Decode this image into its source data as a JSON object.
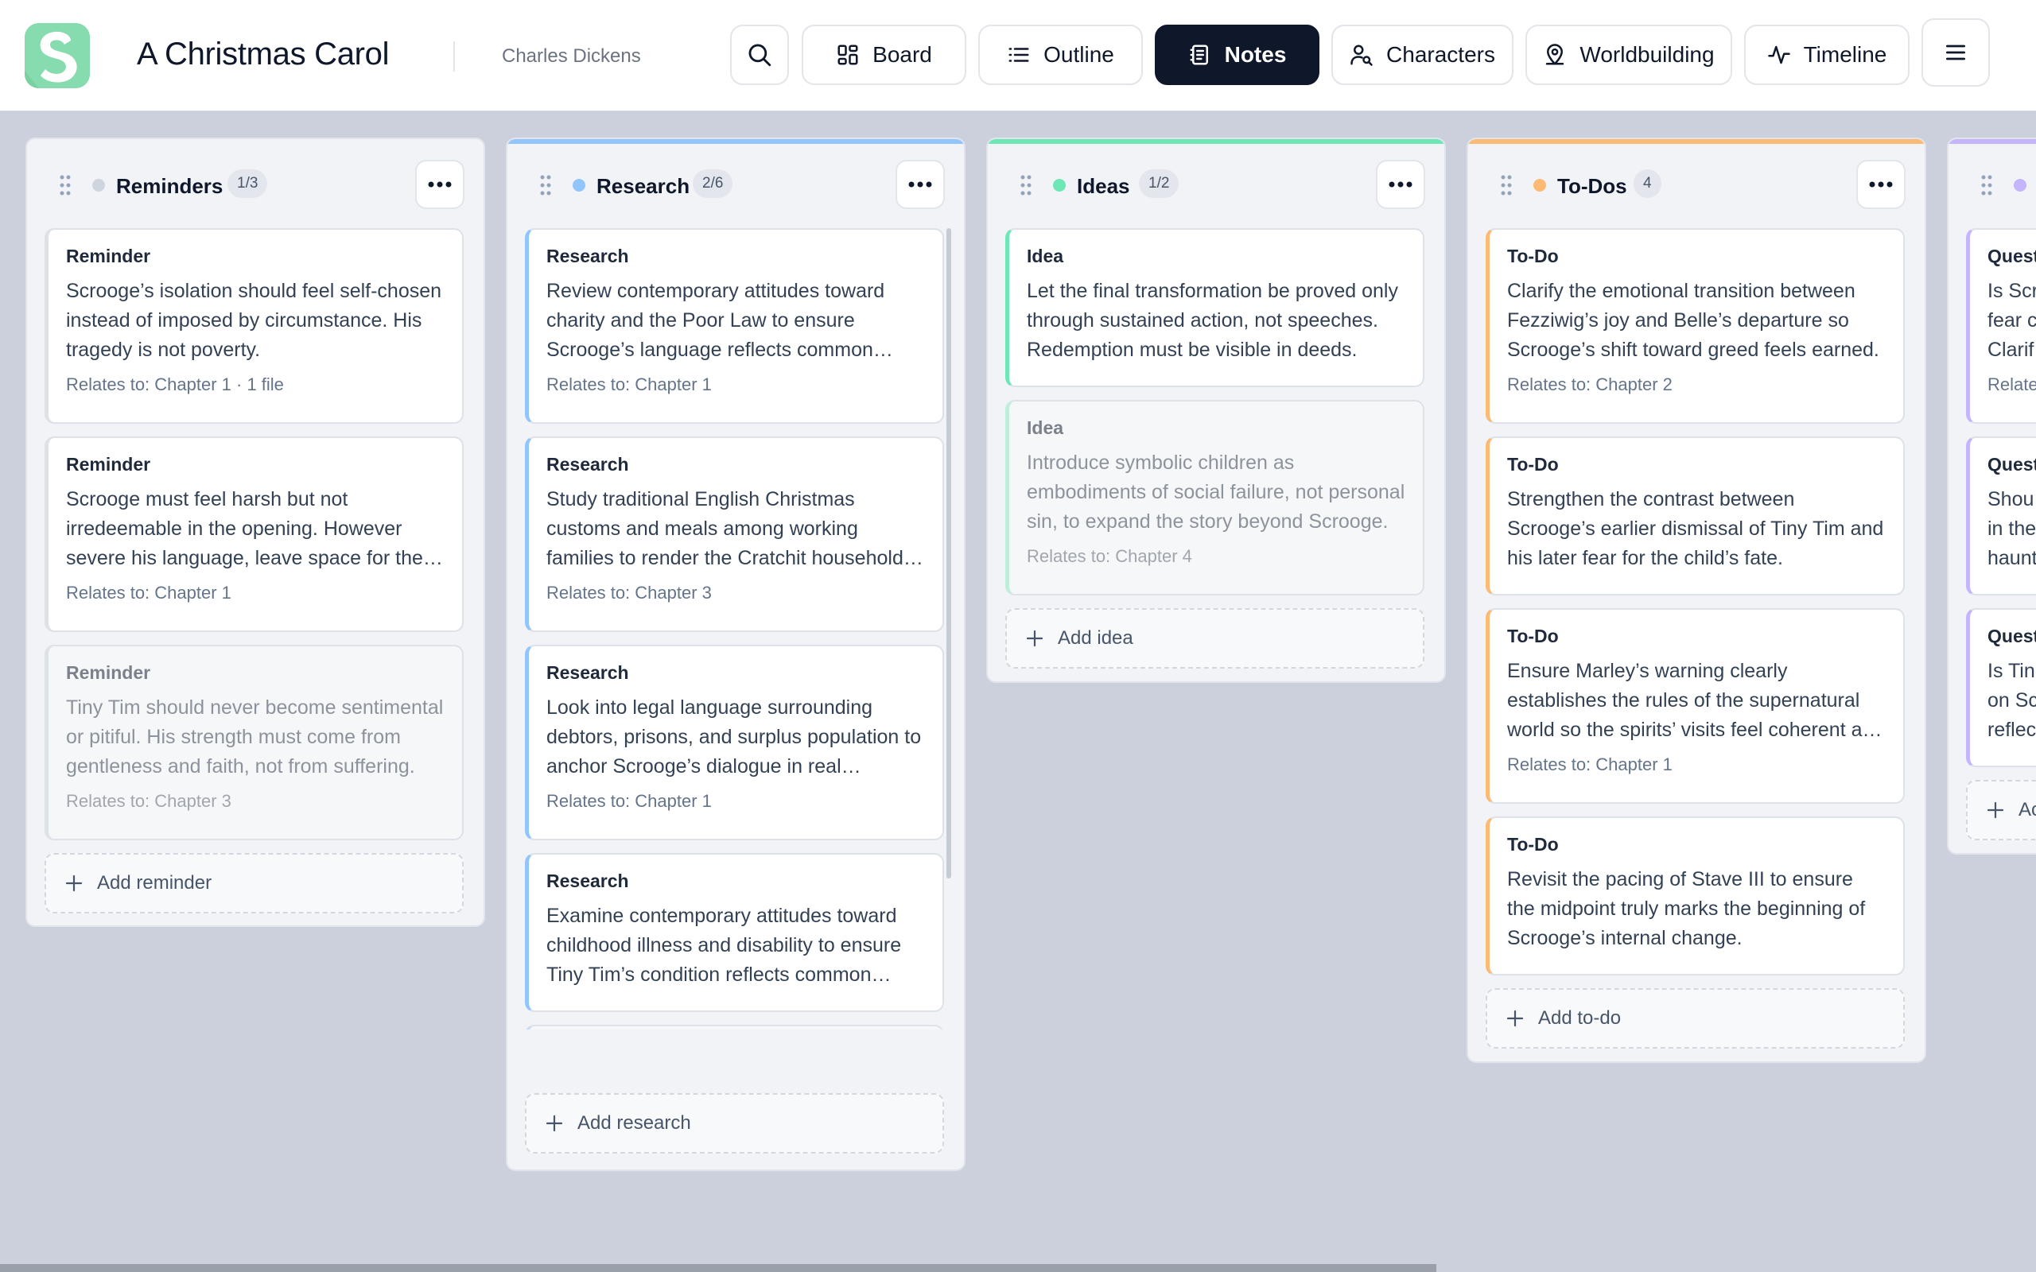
{
  "header": {
    "app_title": "A Christmas Carol",
    "author": "Charles Dickens",
    "logo_icon": "app-logo-s",
    "nav": [
      {
        "label": "Board",
        "icon": "board-icon"
      },
      {
        "label": "Outline",
        "icon": "list-icon"
      },
      {
        "label": "Notes",
        "icon": "notes-icon",
        "active": true
      },
      {
        "label": "Characters",
        "icon": "person-search-icon"
      },
      {
        "label": "Worldbuilding",
        "icon": "map-pin-icon"
      },
      {
        "label": "Timeline",
        "icon": "pulse-icon"
      }
    ]
  },
  "colors": {
    "reminders": "#cfd5df",
    "research": "#93c5fd",
    "ideas": "#6ee7b7",
    "todos": "#fdba74",
    "questions": "#c4b5fd",
    "active_nav": "#0f172a"
  },
  "columns": [
    {
      "title": "Reminders",
      "badge": "1/3",
      "cards": [
        {
          "type": "Reminder",
          "text": "Scrooge’s isolation should feel self-chosen instead of imposed by circumstance. His tragedy is not poverty.",
          "relates": "Relates to: Chapter 1 · 1 file"
        },
        {
          "type": "Reminder",
          "text": "Scrooge must feel harsh but not irredeemable in the opening. However severe his language, leave space for the reader’s hope.",
          "relates": "Relates to: Chapter 1"
        },
        {
          "type": "Reminder",
          "text": "Tiny Tim should never become sentimental or pitiful. His strength must come from gentleness and faith, not from suffering.",
          "relates": "Relates to: Chapter 3",
          "dim": true
        }
      ],
      "add_label": "Add reminder"
    },
    {
      "title": "Research",
      "badge": "2/6",
      "cards": [
        {
          "type": "Research",
          "text": "Review contemporary attitudes toward charity and the Poor Law to ensure Scrooge’s language reflects common opinion of the time.",
          "relates": "Relates to: Chapter 1"
        },
        {
          "type": "Research",
          "text": "Study traditional English Christmas customs and meals among working families to render the Cratchit household accurately.",
          "relates": "Relates to: Chapter 3"
        },
        {
          "type": "Research",
          "text": "Look into legal language surrounding debtors, prisons, and surplus population to anchor Scrooge’s dialogue in real arguments.",
          "relates": "Relates to: Chapter 1"
        },
        {
          "type": "Research",
          "text": "Examine contemporary attitudes toward childhood illness and disability to ensure Tiny Tim’s condition reflects common understanding.",
          "relates": ""
        },
        {
          "type": "Research",
          "text": "",
          "relates": "",
          "dim": true
        }
      ],
      "add_label": "Add research"
    },
    {
      "title": "Ideas",
      "badge": "1/2",
      "cards": [
        {
          "type": "Idea",
          "text": "Let the final transformation be proved only through sustained action, not speeches. Redemption must be visible in deeds.",
          "relates": ""
        },
        {
          "type": "Idea",
          "text": "Introduce symbolic children as embodiments of social failure, not personal sin, to expand the story beyond Scrooge.",
          "relates": "Relates to: Chapter 4",
          "dim": true
        }
      ],
      "add_label": "Add idea"
    },
    {
      "title": "To-Dos",
      "badge": "4",
      "cards": [
        {
          "type": "To-Do",
          "text": "Clarify the emotional transition between Fezziwig’s joy and Belle’s departure so Scrooge’s shift toward greed feels earned.",
          "relates": "Relates to: Chapter 2"
        },
        {
          "type": "To-Do",
          "text": "Strengthen the contrast between Scrooge’s earlier dismissal of Tiny Tim and his later fear for the child’s fate.",
          "relates": ""
        },
        {
          "type": "To-Do",
          "text": "Ensure Marley’s warning clearly establishes the rules of the supernatural world so the spirits’ visits feel coherent and inevitable.",
          "relates": "Relates to: Chapter 1"
        },
        {
          "type": "To-Do",
          "text": "Revisit the pacing of Stave III to ensure the midpoint truly marks the beginning of Scrooge’s internal change.",
          "relates": ""
        }
      ],
      "add_label": "Add to-do"
    },
    {
      "title": "",
      "badge": "",
      "cards": [
        {
          "type": "Quest",
          "text": "Is Scr fear c Clarif",
          "relates": "Relate"
        },
        {
          "type": "Quest",
          "text": "Shou in the haunt",
          "relates": ""
        },
        {
          "type": "Quest",
          "text": "Is Tin on Sc reflec",
          "relates": ""
        }
      ],
      "add_label": "Ac"
    }
  ]
}
